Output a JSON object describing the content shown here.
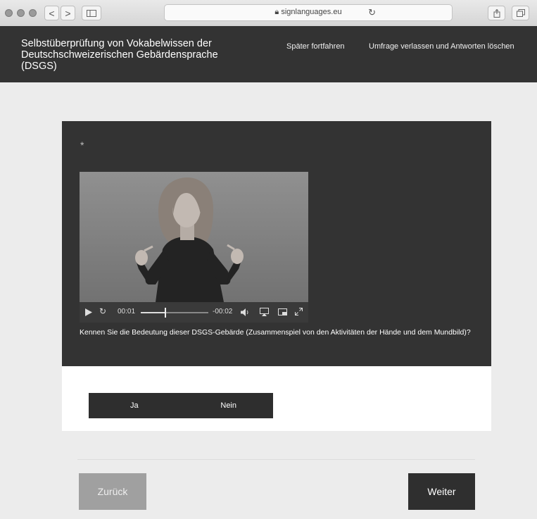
{
  "browser": {
    "url": "signlanguages.eu",
    "tab_buttons": [
      "<",
      ">"
    ],
    "reload_symbol": "↻"
  },
  "header": {
    "title": "Selbstüberprüfung von Vokabelwissen der Deutschschweizerischen Gebärdensprache (DSGS)",
    "links": {
      "later": "Später fortfahren",
      "quit": "Umfrage verlassen und Antworten löschen"
    }
  },
  "question": {
    "required_marker": "*",
    "text": "Kennen Sie die Bedeutung dieser DSGS-Gebärde (Zusammenspiel von den Aktivitäten der Hände und dem Mundbild)?",
    "video": {
      "elapsed": "00:01",
      "remaining": "-00:02",
      "progress": 0.35
    }
  },
  "answers": {
    "yes": "Ja",
    "no": "Nein"
  },
  "navigation": {
    "back": "Zurück",
    "next": "Weiter"
  },
  "colors": {
    "header_bg": "#333333",
    "card_bg": "#333333",
    "back_button": "#a0a0a0",
    "next_button": "#2f2f2f"
  }
}
